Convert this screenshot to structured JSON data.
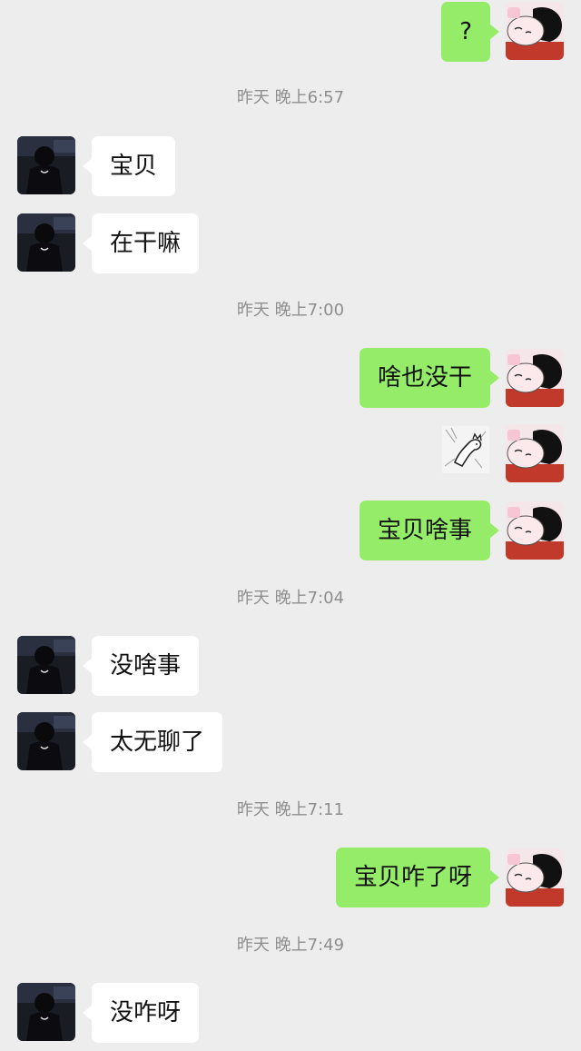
{
  "messages": [
    {
      "type": "out",
      "text": "?"
    },
    {
      "type": "time",
      "text": "昨天 晚上6:57"
    },
    {
      "type": "in",
      "text": "宝贝"
    },
    {
      "type": "in",
      "text": "在干嘛"
    },
    {
      "type": "time",
      "text": "昨天 晚上7:00"
    },
    {
      "type": "out",
      "text": "啥也没干"
    },
    {
      "type": "out_sticker",
      "sticker": "cat-sticker"
    },
    {
      "type": "out",
      "text": "宝贝啥事"
    },
    {
      "type": "time",
      "text": "昨天 晚上7:04"
    },
    {
      "type": "in",
      "text": "没啥事"
    },
    {
      "type": "in",
      "text": "太无聊了"
    },
    {
      "type": "time",
      "text": "昨天 晚上7:11"
    },
    {
      "type": "out",
      "text": "宝贝咋了呀"
    },
    {
      "type": "time",
      "text": "昨天 晚上7:49"
    },
    {
      "type": "in",
      "text": "没咋呀"
    }
  ],
  "colors": {
    "background": "#ededed",
    "outgoing_bubble": "#95ec69",
    "incoming_bubble": "#ffffff",
    "timestamp_text": "#8e8e8e"
  }
}
